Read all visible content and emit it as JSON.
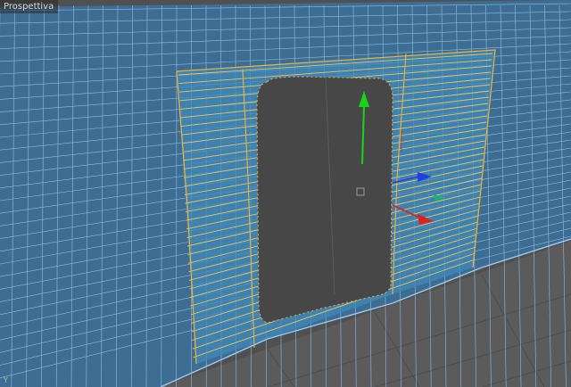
{
  "viewport": {
    "label": "Prospettiva",
    "axis_hint": "Y",
    "colors": {
      "background": "#505050",
      "wall_fill": "#3f6e94",
      "wire": "#a9d3f2",
      "selection_fill": "#3f8ab8",
      "selection_edge": "#f0b33a",
      "door": "#474747",
      "floor": "#5a5a5a",
      "axis_y": "#19d419",
      "axis_x": "#e02020",
      "axis_z": "#2040e0"
    }
  },
  "gizmo": {
    "y_icon": "arrow-y-icon",
    "x_icon": "arrow-x-icon",
    "z_icon": "arrow-z-icon",
    "center_icon": "gizmo-center-icon"
  }
}
